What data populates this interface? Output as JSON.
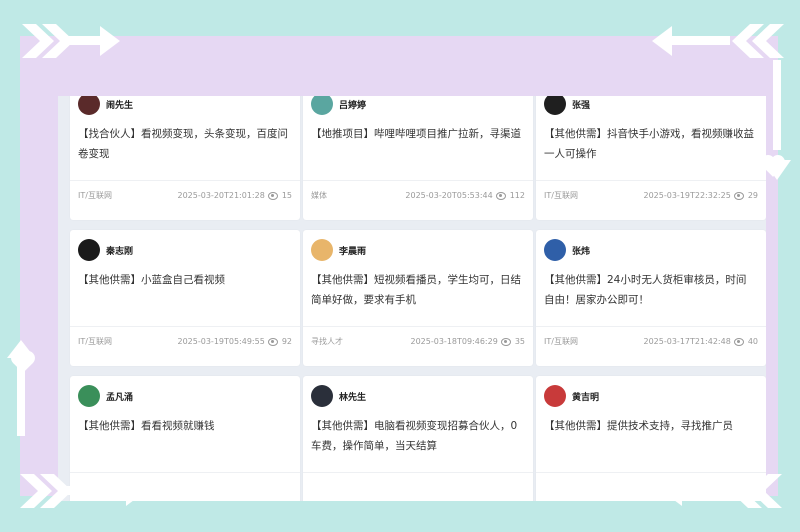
{
  "cards": [
    {
      "name": "闹先生",
      "desc": "【找合伙人】看视频变现，头条变现，百度问卷变现",
      "category": "IT/互联网",
      "time": "2025-03-20T21:01:28",
      "views": "15",
      "avatar": "#5a2a2a"
    },
    {
      "name": "吕婷婷",
      "desc": "【地推项目】哔哩哔哩项目推广拉新，寻渠道",
      "category": "媒体",
      "time": "2025-03-20T05:53:44",
      "views": "112",
      "avatar": "#5aa6a0"
    },
    {
      "name": "张强",
      "desc": "【其他供需】抖音快手小游戏，看视频赚收益一人可操作",
      "category": "IT/互联网",
      "time": "2025-03-19T22:32:25",
      "views": "29",
      "avatar": "#1f1f1f"
    },
    {
      "name": "秦志刚",
      "desc": "【其他供需】小蓝盒自己看视频",
      "category": "IT/互联网",
      "time": "2025-03-19T05:49:55",
      "views": "92",
      "avatar": "#1a1a1a"
    },
    {
      "name": "李晨雨",
      "desc": "【其他供需】短视频看播员，学生均可，日结简单好做，要求有手机",
      "category": "寻找人才",
      "time": "2025-03-18T09:46:29",
      "views": "35",
      "avatar": "#e8b56a"
    },
    {
      "name": "张炜",
      "desc": "【其他供需】24小时无人货柜审核员，时间自由！居家办公即可！",
      "category": "IT/互联网",
      "time": "2025-03-17T21:42:48",
      "views": "40",
      "avatar": "#2f5fa8"
    },
    {
      "name": "孟凡涌",
      "desc": "【其他供需】看看视频就赚钱",
      "category": "",
      "time": "",
      "views": "",
      "avatar": "#3a8f5a"
    },
    {
      "name": "林先生",
      "desc": "【其他供需】电脑看视频变现招募合伙人，0车费，操作简单，当天结算",
      "category": "",
      "time": "",
      "views": "",
      "avatar": "#2a2f3a"
    },
    {
      "name": "黄吉明",
      "desc": "【其他供需】提供技术支持，寻找推广员",
      "category": "",
      "time": "",
      "views": "",
      "avatar": "#c83a3a"
    }
  ]
}
